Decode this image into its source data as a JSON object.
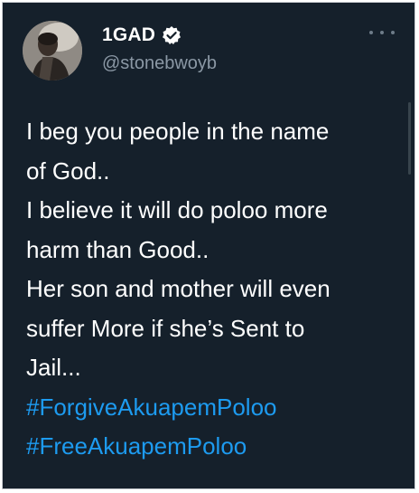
{
  "tweet": {
    "display_name": "1GAD",
    "handle": "@stonebwoyb",
    "verified_icon": "verified-badge-icon",
    "more_icon": "more-options-icon",
    "text_lines": [
      "I beg you people in the name",
      "of God..",
      "I believe it will do poloo more",
      "harm than Good..",
      "Her son and mother will even",
      "suffer More if she’s Sent to",
      "Jail..."
    ],
    "hashtags": [
      "#ForgiveAkuapemPoloo",
      "#FreeAkuapemPoloo"
    ]
  },
  "colors": {
    "background": "#15202b",
    "text": "#ffffff",
    "secondary_text": "#8b98a5",
    "hashtag": "#1d9bf0"
  }
}
